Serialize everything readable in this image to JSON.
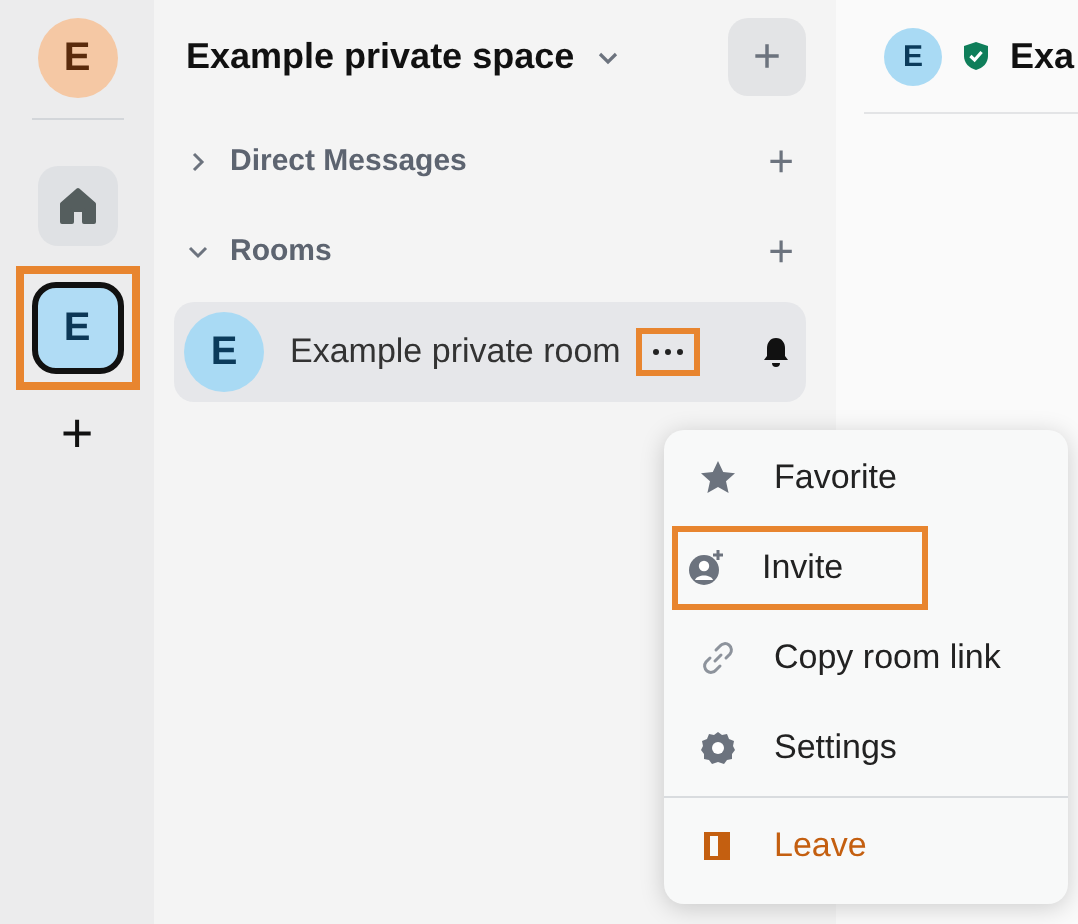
{
  "rail": {
    "user_avatar": "E",
    "items": [
      {
        "kind": "home",
        "selected": false,
        "highlighted": false
      },
      {
        "kind": "space",
        "label": "E",
        "selected": true,
        "highlighted": true
      }
    ],
    "add_symbol": "+"
  },
  "room_list": {
    "title": "Example private space",
    "add_symbol": "+",
    "sections": [
      {
        "title": "Direct Messages",
        "expanded": false,
        "add_symbol": "+"
      },
      {
        "title": "Rooms",
        "expanded": true,
        "add_symbol": "+"
      }
    ],
    "rooms": [
      {
        "avatar": "E",
        "name": "Example private room",
        "selected": true,
        "more_highlighted": true
      }
    ]
  },
  "header": {
    "avatar": "E",
    "title": "Exa"
  },
  "context_menu": {
    "items": [
      {
        "kind": "favorite",
        "label": "Favorite",
        "danger": false,
        "highlighted": false
      },
      {
        "kind": "invite",
        "label": "Invite",
        "danger": false,
        "highlighted": true
      },
      {
        "kind": "link",
        "label": "Copy room link",
        "danger": false,
        "highlighted": false
      },
      {
        "kind": "settings",
        "label": "Settings",
        "danger": false,
        "highlighted": false
      },
      {
        "kind": "leave",
        "label": "Leave",
        "danger": true,
        "highlighted": false
      }
    ]
  }
}
